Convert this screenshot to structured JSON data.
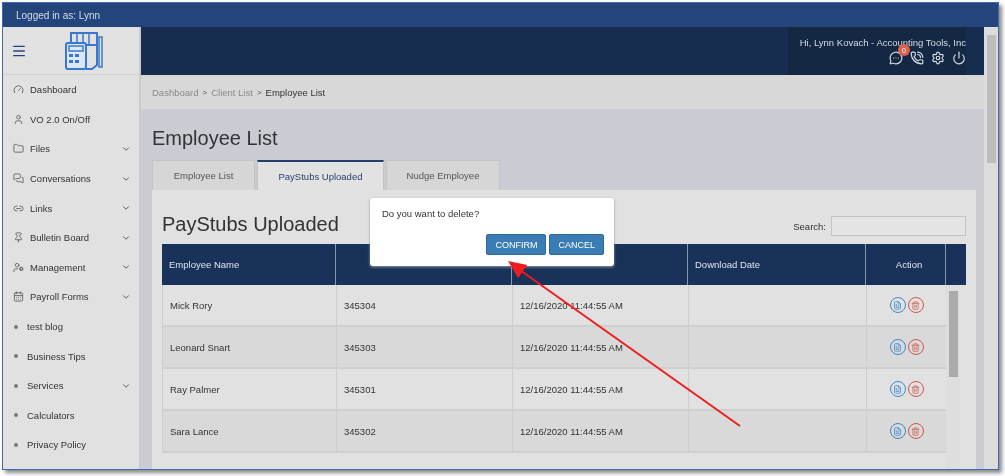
{
  "top_bar": {
    "text": "Logged in as: Lynn"
  },
  "header": {
    "greeting": "Hi, Lynn Kovach - Accounting Tools, Inc",
    "notification_count": "0"
  },
  "sidebar": {
    "items": [
      {
        "label": "Dashboard",
        "kind": "icon",
        "expandable": false
      },
      {
        "label": "VO 2.0 On/Off",
        "kind": "icon",
        "expandable": false
      },
      {
        "label": "Files",
        "kind": "icon",
        "expandable": true
      },
      {
        "label": "Conversations",
        "kind": "icon",
        "expandable": true
      },
      {
        "label": "Links",
        "kind": "icon",
        "expandable": true
      },
      {
        "label": "Bulletin Board",
        "kind": "icon",
        "expandable": true
      },
      {
        "label": "Management",
        "kind": "icon",
        "expandable": true
      },
      {
        "label": "Payroll Forms",
        "kind": "icon",
        "expandable": true
      },
      {
        "label": "test blog",
        "kind": "bullet",
        "expandable": false
      },
      {
        "label": "Business Tips",
        "kind": "bullet",
        "expandable": false
      },
      {
        "label": "Services",
        "kind": "bullet",
        "expandable": true
      },
      {
        "label": "Calculators",
        "kind": "bullet",
        "expandable": false
      },
      {
        "label": "Privacy Policy",
        "kind": "bullet",
        "expandable": false
      }
    ]
  },
  "breadcrumb": [
    {
      "label": "Dashboard",
      "current": false
    },
    {
      "label": "Client List",
      "current": false
    },
    {
      "label": "Employee List",
      "current": true
    }
  ],
  "breadcrumb_separator": ">",
  "page_title": "Employee List",
  "tabs": [
    {
      "label": "Employee List",
      "selected": false
    },
    {
      "label": "PayStubs Uploaded",
      "selected": true
    },
    {
      "label": "Nudge Employee",
      "selected": false
    }
  ],
  "panel": {
    "title": "PayStubs Uploaded",
    "search_label": "Search:"
  },
  "table": {
    "columns": [
      "Employee Name",
      "",
      "",
      "Download Date",
      "Action"
    ],
    "rows": [
      {
        "employee_name": "Mick Rory",
        "employee_id": "345304",
        "created_date": "12/16/2020 11:44:55 AM"
      },
      {
        "employee_name": "Leonard Snart",
        "employee_id": "345303",
        "created_date": "12/16/2020 11:44:55 AM"
      },
      {
        "employee_name": "Ray Palmer",
        "employee_id": "345301",
        "created_date": "12/16/2020 11:44:55 AM"
      },
      {
        "employee_name": "Sara Lance",
        "employee_id": "345302",
        "created_date": "12/16/2020 11:44:55 AM"
      }
    ]
  },
  "dialog": {
    "message": "Do you want to delete?",
    "buttons": [
      "CONFIRM",
      "CANCEL"
    ]
  }
}
